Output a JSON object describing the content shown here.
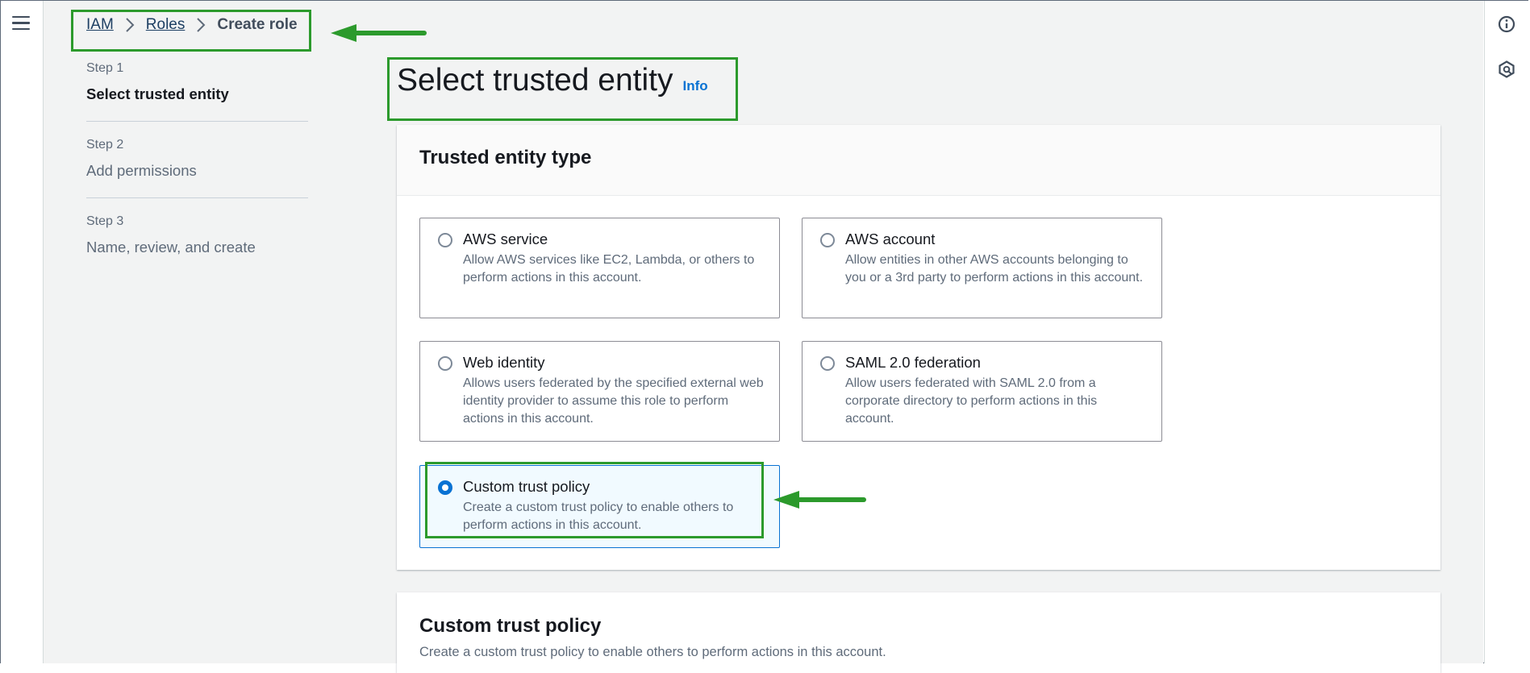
{
  "nav": {
    "menu_icon": "hamburger-menu-icon"
  },
  "breadcrumb": {
    "items": [
      {
        "label": "IAM"
      },
      {
        "label": "Roles"
      }
    ],
    "current": "Create role"
  },
  "steps": [
    {
      "number": "Step 1",
      "title": "Select trusted entity",
      "active": true
    },
    {
      "number": "Step 2",
      "title": "Add permissions",
      "active": false
    },
    {
      "number": "Step 3",
      "title": "Name, review, and create",
      "active": false
    }
  ],
  "page": {
    "title": "Select trusted entity",
    "info_link": "Info"
  },
  "trusted_entity": {
    "title": "Trusted entity type",
    "options": [
      {
        "label": "AWS service",
        "description": "Allow AWS services like EC2, Lambda, or others to perform actions in this account.",
        "selected": false
      },
      {
        "label": "AWS account",
        "description": "Allow entities in other AWS accounts belonging to you or a 3rd party to perform actions in this account.",
        "selected": false
      },
      {
        "label": "Web identity",
        "description": "Allows users federated by the specified external web identity provider to assume this role to perform actions in this account.",
        "selected": false
      },
      {
        "label": "SAML 2.0 federation",
        "description": "Allow users federated with SAML 2.0 from a corporate directory to perform actions in this account.",
        "selected": false
      },
      {
        "label": "Custom trust policy",
        "description": "Create a custom trust policy to enable others to perform actions in this account.",
        "selected": true
      }
    ]
  },
  "custom_trust_policy": {
    "title": "Custom trust policy",
    "description": "Create a custom trust policy to enable others to perform actions in this account."
  },
  "right_rail": {
    "icons": [
      "info-circle-icon",
      "help-panel-icon"
    ]
  },
  "colors": {
    "accent": "#0972d3",
    "annotation": "#2c9a2c"
  }
}
